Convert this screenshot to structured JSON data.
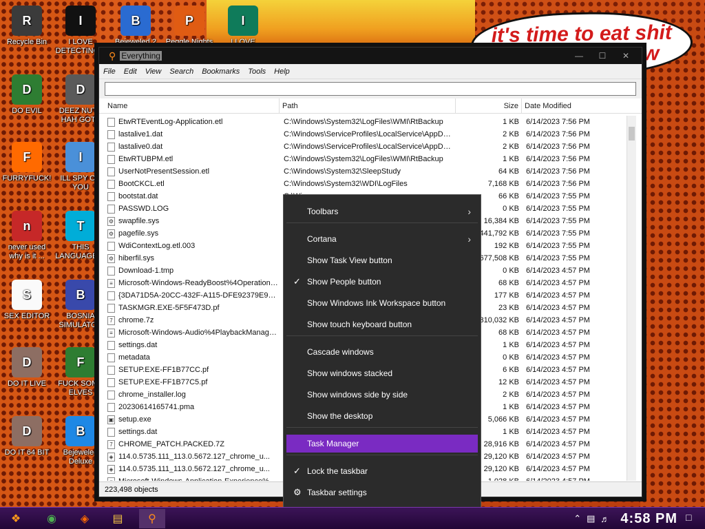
{
  "speech": {
    "line1": "it's time to eat shit",
    "line2": "w"
  },
  "desktop_icons": [
    {
      "label": "Recycle Bin",
      "icon": "recycle-bin-icon",
      "color": "#3b3b3b"
    },
    {
      "label": "I LOVE DETECTING...",
      "icon": "detective-icon",
      "color": "#111111"
    },
    {
      "label": "Bejeweled 2",
      "icon": "bejeweled-icon",
      "color": "#2a6bd1"
    },
    {
      "label": "Peggle Nights",
      "icon": "peggle-icon",
      "color": "#e05c13"
    },
    {
      "label": "I LOVE",
      "icon": "publisher-icon",
      "color": "#0f7b5a"
    },
    {
      "label": "DO EVIL",
      "icon": "chrome-icon",
      "color": "#2e7d32"
    },
    {
      "label": "DEEZ NUTS HAH GOTT",
      "icon": "windows-icon",
      "color": "#5a5a5a"
    },
    {
      "label": "FURRYFUCK!",
      "icon": "firefox-icon",
      "color": "#ff6a00"
    },
    {
      "label": "ILL SPY ON YOU",
      "icon": "network-icon",
      "color": "#4a90d9"
    },
    {
      "label": "never used why is it ...",
      "icon": "devcpp-icon",
      "color": "#c62828"
    },
    {
      "label": "THIS LANGUAGE ...",
      "icon": "go-icon",
      "color": "#00add8"
    },
    {
      "label": "SEX EDITOR",
      "icon": "hxd-icon",
      "color": "#fafafa"
    },
    {
      "label": "BOSNIA SIMULATOR",
      "icon": "mine-icon",
      "color": "#3949ab"
    },
    {
      "label": "DO IT LIVE",
      "icon": "portrait-icon",
      "color": "#8d6e63"
    },
    {
      "label": "FUCK SOME ELVES",
      "icon": "elf-icon",
      "color": "#2e7d32"
    },
    {
      "label": "DO IT 64 BIT",
      "icon": "portrait-icon",
      "color": "#8d6e63"
    },
    {
      "label": "Bejeweled Deluxe",
      "icon": "gem-icon",
      "color": "#1e88e5"
    }
  ],
  "window": {
    "title": "Everything",
    "menus": [
      "File",
      "Edit",
      "View",
      "Search",
      "Bookmarks",
      "Tools",
      "Help"
    ],
    "search_value": "",
    "columns": {
      "name": "Name",
      "path": "Path",
      "size": "Size",
      "date": "Date Modified"
    },
    "status": "223,498 objects"
  },
  "rows": [
    {
      "name": "EtwRTEventLog-Application.etl",
      "path": "C:\\Windows\\System32\\LogFiles\\WMI\\RtBackup",
      "size": "1 KB",
      "date": "6/14/2023 7:56 PM",
      "icon": "file-icon"
    },
    {
      "name": "lastalive1.dat",
      "path": "C:\\Windows\\ServiceProfiles\\LocalService\\AppDat...",
      "size": "2 KB",
      "date": "6/14/2023 7:56 PM",
      "icon": "file-icon"
    },
    {
      "name": "lastalive0.dat",
      "path": "C:\\Windows\\ServiceProfiles\\LocalService\\AppDat...",
      "size": "2 KB",
      "date": "6/14/2023 7:56 PM",
      "icon": "file-icon"
    },
    {
      "name": "EtwRTUBPM.etl",
      "path": "C:\\Windows\\System32\\LogFiles\\WMI\\RtBackup",
      "size": "1 KB",
      "date": "6/14/2023 7:56 PM",
      "icon": "file-icon"
    },
    {
      "name": "UserNotPresentSession.etl",
      "path": "C:\\Windows\\System32\\SleepStudy",
      "size": "64 KB",
      "date": "6/14/2023 7:56 PM",
      "icon": "file-icon"
    },
    {
      "name": "BootCKCL.etl",
      "path": "C:\\Windows\\System32\\WDI\\LogFiles",
      "size": "7,168 KB",
      "date": "6/14/2023 7:56 PM",
      "icon": "file-icon"
    },
    {
      "name": "bootstat.dat",
      "path": "C:\\Wi...",
      "size": "66 KB",
      "date": "6/14/2023 7:55 PM",
      "icon": "file-icon"
    },
    {
      "name": "PASSWD.LOG",
      "path": "",
      "size": "0 KB",
      "date": "6/14/2023 7:55 PM",
      "icon": "file-icon"
    },
    {
      "name": "swapfile.sys",
      "path": "",
      "size": "16,384 KB",
      "date": "6/14/2023 7:55 PM",
      "icon": "sys-file-icon"
    },
    {
      "name": "pagefile.sys",
      "path": "",
      "size": "441,792 KB",
      "date": "6/14/2023 7:55 PM",
      "icon": "sys-file-icon"
    },
    {
      "name": "WdiContextLog.etl.003",
      "path": "",
      "size": "192 KB",
      "date": "6/14/2023 7:55 PM",
      "icon": "file-icon"
    },
    {
      "name": "hiberfil.sys",
      "path": "",
      "size": "677,508 KB",
      "date": "6/14/2023 7:55 PM",
      "icon": "sys-file-icon"
    },
    {
      "name": "Download-1.tmp",
      "path": "",
      "size": "0 KB",
      "date": "6/14/2023 4:57 PM",
      "icon": "file-icon"
    },
    {
      "name": "Microsoft-Windows-ReadyBoost%4Operational...",
      "path": "",
      "size": "68 KB",
      "date": "6/14/2023 4:57 PM",
      "icon": "event-log-icon"
    },
    {
      "name": "{3DA71D5A-20CC-432F-A115-DFE92379E91F}...",
      "path": "",
      "size": "177 KB",
      "date": "6/14/2023 4:57 PM",
      "icon": "file-icon"
    },
    {
      "name": "TASKMGR.EXE-5F5F473D.pf",
      "path": "",
      "size": "23 KB",
      "date": "6/14/2023 4:57 PM",
      "icon": "file-icon"
    },
    {
      "name": "chrome.7z",
      "path": "",
      "size": "310,032 KB",
      "date": "6/14/2023 4:57 PM",
      "icon": "archive-icon"
    },
    {
      "name": "Microsoft-Windows-Audio%4PlaybackManager...",
      "path": "",
      "size": "68 KB",
      "date": "6/14/2023 4:57 PM",
      "icon": "event-log-icon"
    },
    {
      "name": "settings.dat",
      "path": "",
      "size": "1 KB",
      "date": "6/14/2023 4:57 PM",
      "icon": "file-icon"
    },
    {
      "name": "metadata",
      "path": "",
      "size": "0 KB",
      "date": "6/14/2023 4:57 PM",
      "icon": "file-icon"
    },
    {
      "name": "SETUP.EXE-FF1B77CC.pf",
      "path": "",
      "size": "6 KB",
      "date": "6/14/2023 4:57 PM",
      "icon": "file-icon"
    },
    {
      "name": "SETUP.EXE-FF1B77C5.pf",
      "path": "",
      "size": "12 KB",
      "date": "6/14/2023 4:57 PM",
      "icon": "file-icon"
    },
    {
      "name": "chrome_installer.log",
      "path": "",
      "size": "2 KB",
      "date": "6/14/2023 4:57 PM",
      "icon": "file-icon"
    },
    {
      "name": "20230614165741.pma",
      "path": "",
      "size": "1 KB",
      "date": "6/14/2023 4:57 PM",
      "icon": "file-icon"
    },
    {
      "name": "setup.exe",
      "path": "",
      "size": "5,066 KB",
      "date": "6/14/2023 4:57 PM",
      "icon": "exe-icon"
    },
    {
      "name": "settings.dat",
      "path": "",
      "size": "1 KB",
      "date": "6/14/2023 4:57 PM",
      "icon": "file-icon"
    },
    {
      "name": "CHROME_PATCH.PACKED.7Z",
      "path": "",
      "size": "28,916 KB",
      "date": "6/14/2023 4:57 PM",
      "icon": "archive-icon"
    },
    {
      "name": "114.0.5735.111_113.0.5672.127_chrome_u...",
      "path": "",
      "size": "29,120 KB",
      "date": "6/14/2023 4:57 PM",
      "icon": "package-icon"
    },
    {
      "name": "114.0.5735.111_113.0.5672.127_chrome_u...",
      "path": "",
      "size": "29,120 KB",
      "date": "6/14/2023 4:57 PM",
      "icon": "package-icon"
    },
    {
      "name": "Microsoft-Windows-Application-Experience%4...",
      "path": "",
      "size": "1,028 KB",
      "date": "6/14/2023 4:57 PM",
      "icon": "event-log-icon"
    }
  ],
  "context_menu": [
    {
      "label": "Toolbars",
      "submenu": true,
      "checked": false
    },
    {
      "label": "Cortana",
      "submenu": true,
      "checked": false
    },
    {
      "label": "Show Task View button",
      "submenu": false,
      "checked": false
    },
    {
      "label": "Show People button",
      "submenu": false,
      "checked": true
    },
    {
      "label": "Show Windows Ink Workspace button",
      "submenu": false,
      "checked": false
    },
    {
      "label": "Show touch keyboard button",
      "submenu": false,
      "checked": false
    },
    {
      "label": "Cascade windows",
      "submenu": false,
      "checked": false
    },
    {
      "label": "Show windows stacked",
      "submenu": false,
      "checked": false
    },
    {
      "label": "Show windows side by side",
      "submenu": false,
      "checked": false
    },
    {
      "label": "Show the desktop",
      "submenu": false,
      "checked": false
    },
    {
      "label": "Task Manager",
      "submenu": false,
      "checked": false,
      "highlighted": true
    },
    {
      "label": "Lock the taskbar",
      "submenu": false,
      "checked": true
    },
    {
      "label": "Taskbar settings",
      "submenu": false,
      "checked": false,
      "icon": "gear-icon"
    }
  ],
  "taskbar": {
    "apps": [
      "start-icon",
      "chrome-icon",
      "firefox-icon",
      "file-explorer-icon",
      "everything-search-icon"
    ],
    "clock": "4:58 PM",
    "accent": "#7a2bc2"
  }
}
